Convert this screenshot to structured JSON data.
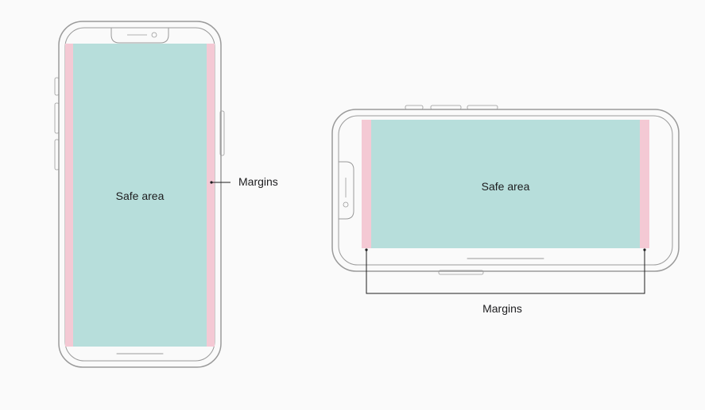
{
  "diagram": {
    "portrait": {
      "safe_area_label": "Safe area",
      "margins_label": "Margins"
    },
    "landscape": {
      "safe_area_label": "Safe area",
      "margins_label": "Margins"
    },
    "colors": {
      "safe_area": "#b7dedb",
      "margin": "#f4c9d4",
      "device_stroke": "#9a9a9a",
      "text": "#1d1d1f",
      "background": "#fafafa"
    }
  }
}
